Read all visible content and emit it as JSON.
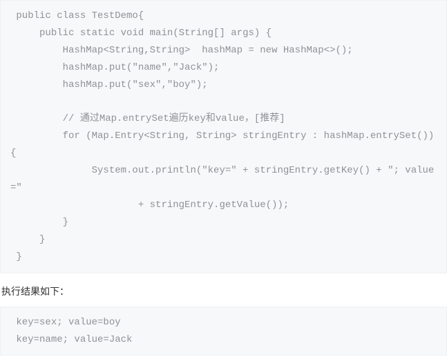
{
  "code_block": {
    "code": " public class TestDemo{\n     public static void main(String[] args) {\n         HashMap<String,String>  hashMap = new HashMap<>();\n         hashMap.put(\"name\",\"Jack\");\n         hashMap.put(\"sex\",\"boy\");\n\n         // 通过Map.entrySet遍历key和value，[推荐]\n         for (Map.Entry<String, String> stringEntry : hashMap.entrySet()){\n              System.out.println(\"key=\" + stringEntry.getKey() + \"; value=\"\n                      + stringEntry.getValue());\n         }\n     }\n }"
  },
  "result": {
    "heading": "执行结果如下：",
    "output": " key=sex; value=boy\n key=name; value=Jack"
  }
}
